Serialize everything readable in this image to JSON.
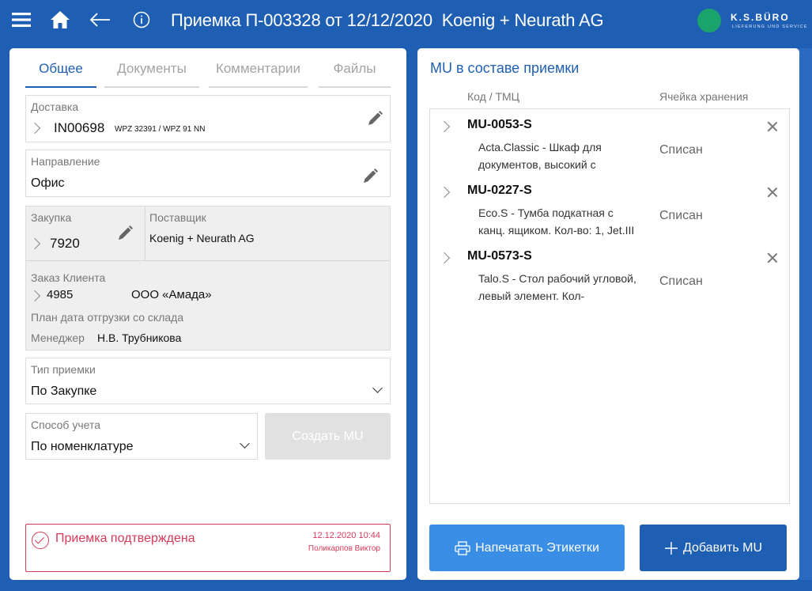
{
  "header": {
    "title": "Приемка П-003328 от 12/12/2020  Koenig + Neurath AG",
    "logo_text": "K.S.BÜRO",
    "logo_sub": "Lieferung und Service",
    "logo_color": "#1aa36a",
    "icons": [
      "menu-icon",
      "home-icon",
      "back-arrow-icon",
      "info-icon"
    ]
  },
  "tabs": [
    {
      "label": "Общее",
      "active": true
    },
    {
      "label": "Документы",
      "active": false
    },
    {
      "label": "Комментарии",
      "active": false
    },
    {
      "label": "Файлы",
      "active": false
    }
  ],
  "delivery": {
    "label": "Доставка",
    "value": "IN00698",
    "sub": "WPZ 32391 / WPZ 91 NN"
  },
  "direction": {
    "label": "Направление",
    "value": "Офис"
  },
  "purchase": {
    "label": "Закупка",
    "value": "7920"
  },
  "supplier": {
    "label": "Поставщик",
    "value": "Koenig + Neurath AG"
  },
  "order": {
    "label": "Заказ Клиента",
    "number": "4985",
    "customer": "ООО «Амада»",
    "ship_date_label": "План дата отгрузки со склада",
    "manager_label": "Менеджер",
    "manager": "Н.В. Трубникова"
  },
  "receipt_type": {
    "label": "Тип приемки",
    "value": "По Закупке"
  },
  "accounting": {
    "label": "Способ учета",
    "value": "По номенклатуре"
  },
  "create_mu_label": "Создать MU",
  "status": {
    "text": "Приемка подтверждена",
    "datetime": "12.12.2020 10:44",
    "user": "Поликарпов Виктор",
    "color": "#d63a5a"
  },
  "mu_panel": {
    "title": "MU в составе приемки",
    "col_code": "Код / ТМЦ",
    "col_cell": "Ячейка хранения",
    "items": [
      {
        "code": "MU-0053-S",
        "desc": "Acta.Classic - Шкаф для документов, высокий с",
        "cell": "Списан"
      },
      {
        "code": "MU-0227-S",
        "desc": "Eco.S - Тумба подкатная с канц. ящиком. Кол-во: 1, Jet.III",
        "cell": "Списан"
      },
      {
        "code": "MU-0573-S",
        "desc": "Talo.S - Стол рабочий угловой, левый элемент. Кол-",
        "cell": "Списан"
      }
    ],
    "print_label": "Напечатать Этикетки",
    "add_label": "Добавить MU"
  },
  "accent_color": "#1f5fb3"
}
